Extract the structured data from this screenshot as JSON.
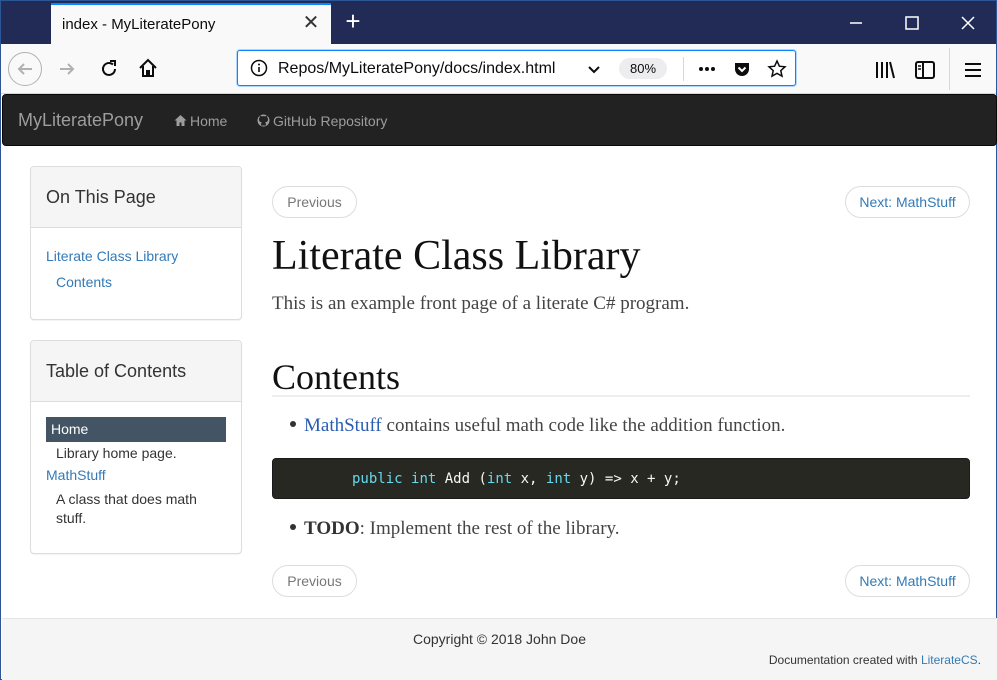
{
  "browser": {
    "tab_title": "index - MyLiteratePony",
    "url": "Repos/MyLiteratePony/docs/index.html",
    "zoom": "80%"
  },
  "site": {
    "brand": "MyLiteratePony",
    "nav": [
      {
        "label": "Home",
        "icon": "home-icon"
      },
      {
        "label": "GitHub Repository",
        "icon": "github-icon"
      }
    ]
  },
  "sidebar": {
    "on_this_page": {
      "title": "On This Page",
      "items": [
        "Literate Class Library",
        "Contents"
      ]
    },
    "toc": {
      "title": "Table of Contents",
      "items": [
        {
          "label": "Home",
          "description": "Library home page.",
          "active": true
        },
        {
          "label": "MathStuff",
          "description": "A class that does math stuff.",
          "active": false
        }
      ]
    }
  },
  "pager": {
    "previous": "Previous",
    "next": "Next: MathStuff"
  },
  "content": {
    "title": "Literate Class Library",
    "lead": "This is an example front page of a literate C# program.",
    "section_heading": "Contents",
    "bullet1_link": "MathStuff",
    "bullet1_text": " contains useful math code like the addition function.",
    "code": {
      "kw_public": "public",
      "kw_int1": "int",
      "name": " Add (",
      "kw_int2": "int",
      "x": " x, ",
      "kw_int3": "int",
      "rest": " y) => x + y;"
    },
    "bullet2_bold": "TODO",
    "bullet2_text": ": Implement the rest of the library."
  },
  "footer": {
    "copyright": "Copyright © 2018 John Doe",
    "credit_prefix": "Documentation created with ",
    "credit_link": "LiterateCS",
    "credit_suffix": "."
  },
  "colors": {
    "titlebar": "#222a56",
    "navbar": "#222222",
    "link": "#337ab7",
    "toc_active": "#435565",
    "code_bg": "#272822"
  }
}
